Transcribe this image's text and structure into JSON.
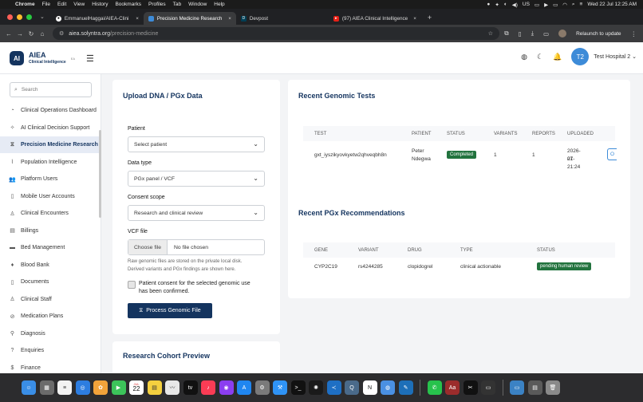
{
  "menubar": {
    "apple": "",
    "app": "Chrome",
    "menus": [
      "File",
      "Edit",
      "View",
      "History",
      "Bookmarks",
      "Profiles",
      "Tab",
      "Window",
      "Help"
    ],
    "datetime": "Wed 22 Jul  12:25 AM",
    "input_source": "US"
  },
  "browser": {
    "tabs": [
      {
        "label": "EmmanuelHaggai/AIEA-Clini",
        "favicon": "github-icon",
        "color": "#111111"
      },
      {
        "label": "Precision Medicine Research",
        "favicon": "aiea-icon",
        "color": "#3d8bd8"
      },
      {
        "label": "Devpost",
        "favicon": "devpost-icon",
        "color": "#003e54"
      },
      {
        "label": "(97) AIEA Clinical Intelligence",
        "favicon": "youtube-icon",
        "color": "#e62117"
      }
    ],
    "new_tab": "+",
    "url_host": "aiea.solyntra.org",
    "url_path": "/precision-medicine",
    "relaunch": "Relaunch to update"
  },
  "app": {
    "logo": {
      "mark": "AI",
      "name": "AIEA",
      "subtitle": "Clinical Intelligence",
      "tag": "EA"
    },
    "user": {
      "initials": "T2",
      "hospital": "Test Hospital 2"
    },
    "search_placeholder": "Search",
    "sidebar": [
      {
        "label": "Clinical Operations Dashboard",
        "icon": "dashboard-icon"
      },
      {
        "label": "AI Clinical Decision Support",
        "icon": "brain-icon"
      },
      {
        "label": "Precision Medicine Research",
        "icon": "dna-icon",
        "active": true
      },
      {
        "label": "Population Intelligence",
        "icon": "chart-icon"
      },
      {
        "label": "Platform Users",
        "icon": "users-icon"
      },
      {
        "label": "Mobile User Accounts",
        "icon": "mobile-icon"
      },
      {
        "label": "Clinical Encounters",
        "icon": "encounter-icon"
      },
      {
        "label": "Billings",
        "icon": "billing-icon"
      },
      {
        "label": "Bed Management",
        "icon": "bed-icon"
      },
      {
        "label": "Blood Bank",
        "icon": "blood-icon"
      },
      {
        "label": "Documents",
        "icon": "document-icon"
      },
      {
        "label": "Clinical Staff",
        "icon": "staff-icon"
      },
      {
        "label": "Medication Plans",
        "icon": "medication-icon"
      },
      {
        "label": "Diagnosis",
        "icon": "diagnosis-icon"
      },
      {
        "label": "Enquiries",
        "icon": "enquiry-icon"
      },
      {
        "label": "Finance",
        "icon": "finance-icon"
      }
    ]
  },
  "upload": {
    "title": "Upload DNA / PGx Data",
    "patient_label": "Patient",
    "patient_value": "Select patient",
    "datatype_label": "Data type",
    "datatype_value": "PGx panel / VCF",
    "consent_label": "Consent scope",
    "consent_value": "Research and clinical review",
    "vcf_label": "VCF file",
    "choose_file": "Choose file",
    "no_file": "No file chosen",
    "help_line1": "Raw genomic files are stored on the private local disk.",
    "help_line2": "Derived variants and PGx findings are shown here.",
    "consent_line1": "Patient consent for the selected genomic use",
    "consent_line2": "has been confirmed.",
    "process_button": "Process Genomic File"
  },
  "cohort": {
    "title": "Research Cohort Preview"
  },
  "tests": {
    "title": "Recent Genomic Tests",
    "headers": [
      "TEST",
      "PATIENT",
      "STATUS",
      "VARIANTS",
      "REPORTS",
      "UPLOADED"
    ],
    "row": {
      "test": "gxt_iyszikyovkyetw2qhveqbh8n",
      "patient1": "Peter",
      "patient2": "Ndegwa",
      "status": "Completed",
      "variants": "1",
      "reports": "1",
      "uploaded1": "2026-07-",
      "uploaded2": "21 21:24",
      "action": "O"
    }
  },
  "pgx": {
    "title": "Recent PGx Recommendations",
    "headers": [
      "GENE",
      "VARIANT",
      "DRUG",
      "TYPE",
      "STATUS"
    ],
    "row": {
      "gene": "CYP2C19",
      "variant": "rs4244285",
      "drug": "clopidogrel",
      "type": "clinical actionable",
      "status": "pending human review"
    }
  },
  "colors": {
    "brand": "#14345f",
    "success": "#22733e",
    "avatar": "#3d8bd8"
  },
  "dock": {
    "calendar_month": "JUL",
    "calendar_day": "22",
    "tv": "tv",
    "dictionary": "Aa"
  }
}
